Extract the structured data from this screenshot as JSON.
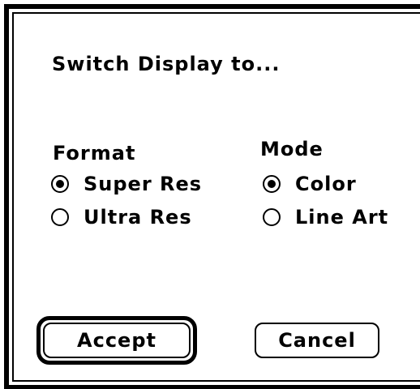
{
  "dialog": {
    "title": "Switch Display to..."
  },
  "format_group": {
    "label": "Format",
    "options": [
      {
        "label": "Super Res",
        "selected": true
      },
      {
        "label": "Ultra Res",
        "selected": false
      }
    ]
  },
  "mode_group": {
    "label": "Mode",
    "options": [
      {
        "label": "Color",
        "selected": true
      },
      {
        "label": "Line Art",
        "selected": false
      }
    ]
  },
  "buttons": {
    "accept_label": "Accept",
    "cancel_label": "Cancel"
  }
}
